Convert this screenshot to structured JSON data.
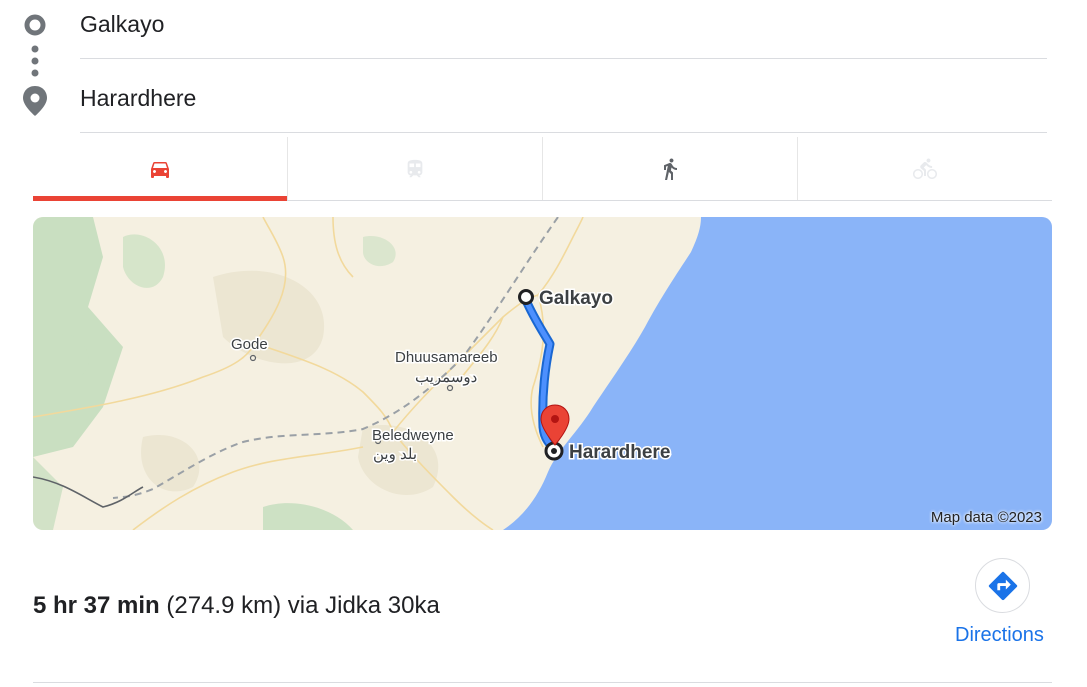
{
  "route": {
    "origin": "Galkayo",
    "destination": "Harardhere"
  },
  "modes": [
    {
      "name": "driving",
      "icon": "car-icon",
      "active": true,
      "color": "#ea4335"
    },
    {
      "name": "transit",
      "icon": "train-icon",
      "active": false
    },
    {
      "name": "walking",
      "icon": "walk-icon",
      "active": false
    },
    {
      "name": "cycling",
      "icon": "bicycle-icon",
      "active": false
    }
  ],
  "map": {
    "labels": {
      "galkayo": "Galkayo",
      "harardhere": "Harardhere",
      "gode": "Gode",
      "dhuusamareeb": "Dhuusamareeb",
      "dhuusamareeb_ar": "دوسمريب",
      "beledweyne": "Beledweyne",
      "beledweyne_ar": "بلد وين"
    },
    "attribution": "Map data ©2023",
    "colors": {
      "land": "#f5f0e1",
      "ocean": "#8ab4f8",
      "route": "#1a73e8",
      "pin": "#ea4335"
    }
  },
  "summary": {
    "duration": "5 hr 37 min",
    "distance": "(274.9 km) via Jidka 30ka"
  },
  "directions": {
    "label": "Directions",
    "icon": "turn-right-icon",
    "color": "#1a73e8"
  }
}
